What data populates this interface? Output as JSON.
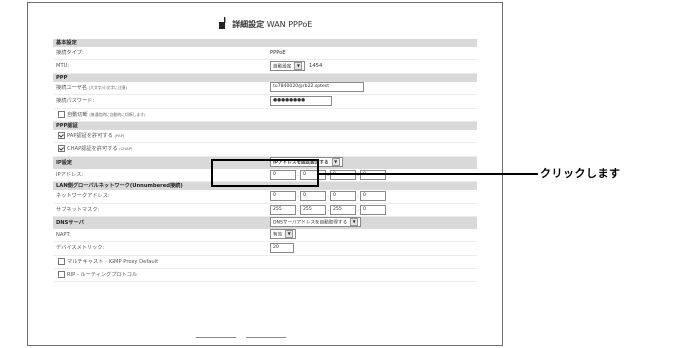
{
  "header": {
    "title_jp": "詳細設定",
    "title_en": "WAN PPPoE"
  },
  "sections": {
    "basic": "基本設定",
    "ppp": "PPP",
    "auth": "PPP認証",
    "ip": "IP設定",
    "lan": "LAN側グローバルネットワーク(Unnumbered接続)",
    "dns": "DNSサーバ"
  },
  "fields": {
    "conn_type_label": "接続タイプ:",
    "conn_type_value": "PPPoE",
    "mtu_label": "MTU:",
    "mtu_select": "自動設定",
    "mtu_value": "1454",
    "user_label": "接続ユーザ名",
    "user_hint": "(大文字/小文字に注意)",
    "user_value": "tu7840020@rb22.sptest",
    "pass_label": "接続パスワード:",
    "pass_value": "●●●●●●●●",
    "auto_disconnect_label": "自動切断",
    "auto_disconnect_hint": "(無通信時に自動的に切断します)",
    "pap_label": "PAP認証を許可する",
    "pap_hint": "(PAP)",
    "chap_label": "CHAP認証を許可する",
    "chap_hint": "(CHAP)",
    "ip_select": "IPアドレスを固定設定する",
    "ip_addr_label": "IPアドレス:",
    "ip_addr": [
      "0",
      "0",
      "0",
      "0"
    ],
    "net_addr_label": "ネットワークアドレス:",
    "net_addr": [
      "0",
      "0",
      "0",
      "0"
    ],
    "subnet_label": "サブネットマスク:",
    "subnet": [
      "255",
      "255",
      "255",
      "0"
    ],
    "dns_select": "DNSサーバアドレスを自動取得する",
    "napt_label": "NAPT:",
    "napt_select": "有効",
    "metric_label": "デバイスメトリック:",
    "metric_value": "20",
    "igmp_label": "マルチキャスト - IGMP Proxy Default",
    "rip_label": "RIP - ルーティングプロトコル"
  },
  "callout": "クリックします"
}
